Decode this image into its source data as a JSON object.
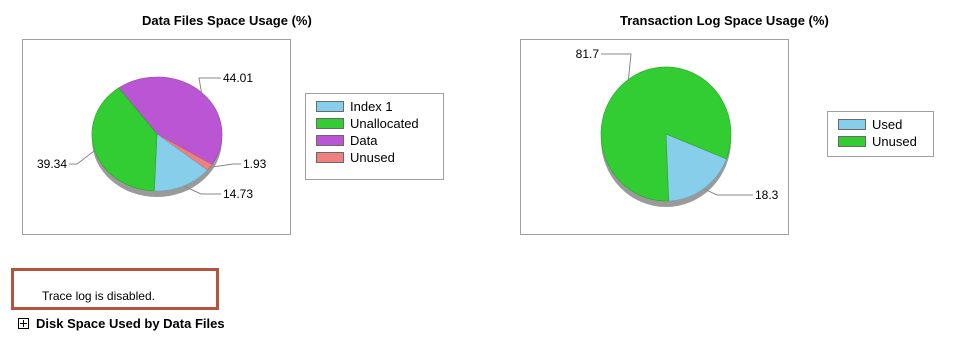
{
  "charts": {
    "data_files": {
      "title": "Data Files Space Usage (%)",
      "legend": [
        {
          "label": "Index 1",
          "color": "#87ceeb"
        },
        {
          "label": "Unallocated",
          "color": "#32cd32"
        },
        {
          "label": "Data",
          "color": "#ba55d3"
        },
        {
          "label": "Unused",
          "color": "#f08080"
        }
      ]
    },
    "transaction_log": {
      "title": "Transaction Log Space Usage (%)",
      "legend": [
        {
          "label": "Used",
          "color": "#87ceeb"
        },
        {
          "label": "Unused",
          "color": "#32cd32"
        }
      ]
    }
  },
  "chart_data": [
    {
      "type": "pie",
      "title": "Data Files Space Usage (%)",
      "slices": [
        {
          "name": "Data",
          "value": 44.01,
          "color": "#ba55d3"
        },
        {
          "name": "Unused",
          "value": 1.93,
          "color": "#f08080"
        },
        {
          "name": "Index 1",
          "value": 14.73,
          "color": "#87ceeb"
        },
        {
          "name": "Unallocated",
          "value": 39.34,
          "color": "#32cd32"
        }
      ],
      "legend_position": "right"
    },
    {
      "type": "pie",
      "title": "Transaction Log Space Usage (%)",
      "slices": [
        {
          "name": "Used",
          "value": 18.3,
          "color": "#87ceeb"
        },
        {
          "name": "Unused",
          "value": 81.7,
          "color": "#32cd32"
        }
      ],
      "legend_position": "right"
    }
  ],
  "status": {
    "trace_message": "Trace log is disabled."
  },
  "sections": {
    "disk_space_header": "Disk Space Used by Data Files"
  }
}
